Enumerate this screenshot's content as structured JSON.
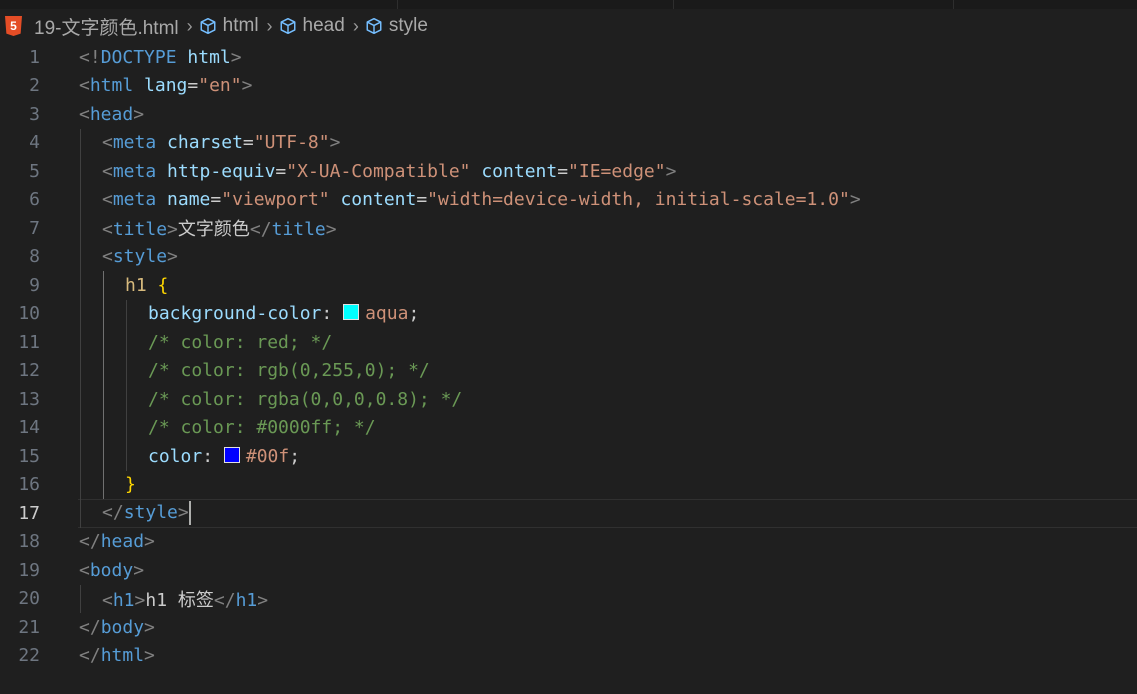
{
  "breadcrumb": {
    "file_icon": "html5-icon",
    "file": "19-文字颜色.html",
    "items": [
      "html",
      "head",
      "style"
    ],
    "item_icon": "cube-icon"
  },
  "editor": {
    "current_line": 17,
    "lines": [
      {
        "n": "1",
        "indent": 0,
        "tokens": [
          [
            "p",
            "<!"
          ],
          [
            "tag",
            "DOCTYPE"
          ],
          [
            "txt",
            " "
          ],
          [
            "attr",
            "html"
          ],
          [
            "p",
            ">"
          ]
        ]
      },
      {
        "n": "2",
        "indent": 0,
        "tokens": [
          [
            "p",
            "<"
          ],
          [
            "tag",
            "html"
          ],
          [
            "txt",
            " "
          ],
          [
            "attr",
            "lang"
          ],
          [
            "txt",
            "="
          ],
          [
            "str",
            "\"en\""
          ],
          [
            "p",
            ">"
          ]
        ]
      },
      {
        "n": "3",
        "indent": 0,
        "tokens": [
          [
            "p",
            "<"
          ],
          [
            "tag",
            "head"
          ],
          [
            "p",
            ">"
          ]
        ]
      },
      {
        "n": "4",
        "indent": 1,
        "tokens": [
          [
            "p",
            "<"
          ],
          [
            "tag",
            "meta"
          ],
          [
            "txt",
            " "
          ],
          [
            "attr",
            "charset"
          ],
          [
            "txt",
            "="
          ],
          [
            "str",
            "\"UTF-8\""
          ],
          [
            "p",
            ">"
          ]
        ]
      },
      {
        "n": "5",
        "indent": 1,
        "tokens": [
          [
            "p",
            "<"
          ],
          [
            "tag",
            "meta"
          ],
          [
            "txt",
            " "
          ],
          [
            "attr",
            "http-equiv"
          ],
          [
            "txt",
            "="
          ],
          [
            "str",
            "\"X-UA-Compatible\""
          ],
          [
            "txt",
            " "
          ],
          [
            "attr",
            "content"
          ],
          [
            "txt",
            "="
          ],
          [
            "str",
            "\"IE=edge\""
          ],
          [
            "p",
            ">"
          ]
        ]
      },
      {
        "n": "6",
        "indent": 1,
        "tokens": [
          [
            "p",
            "<"
          ],
          [
            "tag",
            "meta"
          ],
          [
            "txt",
            " "
          ],
          [
            "attr",
            "name"
          ],
          [
            "txt",
            "="
          ],
          [
            "str",
            "\"viewport\""
          ],
          [
            "txt",
            " "
          ],
          [
            "attr",
            "content"
          ],
          [
            "txt",
            "="
          ],
          [
            "str",
            "\"width=device-width, initial-scale=1.0\""
          ],
          [
            "p",
            ">"
          ]
        ]
      },
      {
        "n": "7",
        "indent": 1,
        "tokens": [
          [
            "p",
            "<"
          ],
          [
            "tag",
            "title"
          ],
          [
            "p",
            ">"
          ],
          [
            "txt",
            "文字颜色"
          ],
          [
            "p",
            "</"
          ],
          [
            "tag",
            "title"
          ],
          [
            "p",
            ">"
          ]
        ]
      },
      {
        "n": "8",
        "indent": 1,
        "tokens": [
          [
            "p",
            "<"
          ],
          [
            "tag",
            "style"
          ],
          [
            "p",
            ">"
          ]
        ]
      },
      {
        "n": "9",
        "indent": 2,
        "tokens": [
          [
            "sel",
            "h1"
          ],
          [
            "txt",
            " "
          ],
          [
            "brace",
            "{"
          ]
        ]
      },
      {
        "n": "10",
        "indent": 3,
        "tokens": [
          [
            "prop",
            "background-color"
          ],
          [
            "punc",
            ": "
          ],
          [
            "swatch",
            "#00ffff"
          ],
          [
            "val",
            "aqua"
          ],
          [
            "punc",
            ";"
          ]
        ]
      },
      {
        "n": "11",
        "indent": 3,
        "tokens": [
          [
            "cmt",
            "/* color: red; */"
          ]
        ]
      },
      {
        "n": "12",
        "indent": 3,
        "tokens": [
          [
            "cmt",
            "/* color: rgb(0,255,0); */"
          ]
        ]
      },
      {
        "n": "13",
        "indent": 3,
        "tokens": [
          [
            "cmt",
            "/* color: rgba(0,0,0,0.8); */"
          ]
        ]
      },
      {
        "n": "14",
        "indent": 3,
        "tokens": [
          [
            "cmt",
            "/* color: #0000ff; */"
          ]
        ]
      },
      {
        "n": "15",
        "indent": 3,
        "tokens": [
          [
            "prop",
            "color"
          ],
          [
            "punc",
            ": "
          ],
          [
            "swatch",
            "#0000ff"
          ],
          [
            "val",
            "#00f"
          ],
          [
            "punc",
            ";"
          ]
        ]
      },
      {
        "n": "16",
        "indent": 2,
        "tokens": [
          [
            "brace",
            "}"
          ]
        ]
      },
      {
        "n": "17",
        "indent": 1,
        "tokens": [
          [
            "p",
            "</"
          ],
          [
            "tag",
            "style"
          ],
          [
            "p",
            ">"
          ],
          [
            "cursor",
            ""
          ]
        ]
      },
      {
        "n": "18",
        "indent": 0,
        "tokens": [
          [
            "p",
            "</"
          ],
          [
            "tag",
            "head"
          ],
          [
            "p",
            ">"
          ]
        ]
      },
      {
        "n": "19",
        "indent": 0,
        "tokens": [
          [
            "p",
            "<"
          ],
          [
            "tag",
            "body"
          ],
          [
            "p",
            ">"
          ]
        ]
      },
      {
        "n": "20",
        "indent": 1,
        "tokens": [
          [
            "p",
            "<"
          ],
          [
            "tag",
            "h1"
          ],
          [
            "p",
            ">"
          ],
          [
            "txt",
            "h1 标签"
          ],
          [
            "p",
            "</"
          ],
          [
            "tag",
            "h1"
          ],
          [
            "p",
            ">"
          ]
        ]
      },
      {
        "n": "21",
        "indent": 0,
        "tokens": [
          [
            "p",
            "</"
          ],
          [
            "tag",
            "body"
          ],
          [
            "p",
            ">"
          ]
        ]
      },
      {
        "n": "22",
        "indent": 0,
        "tokens": [
          [
            "p",
            "</"
          ],
          [
            "tag",
            "html"
          ],
          [
            "p",
            ">"
          ]
        ]
      }
    ]
  }
}
